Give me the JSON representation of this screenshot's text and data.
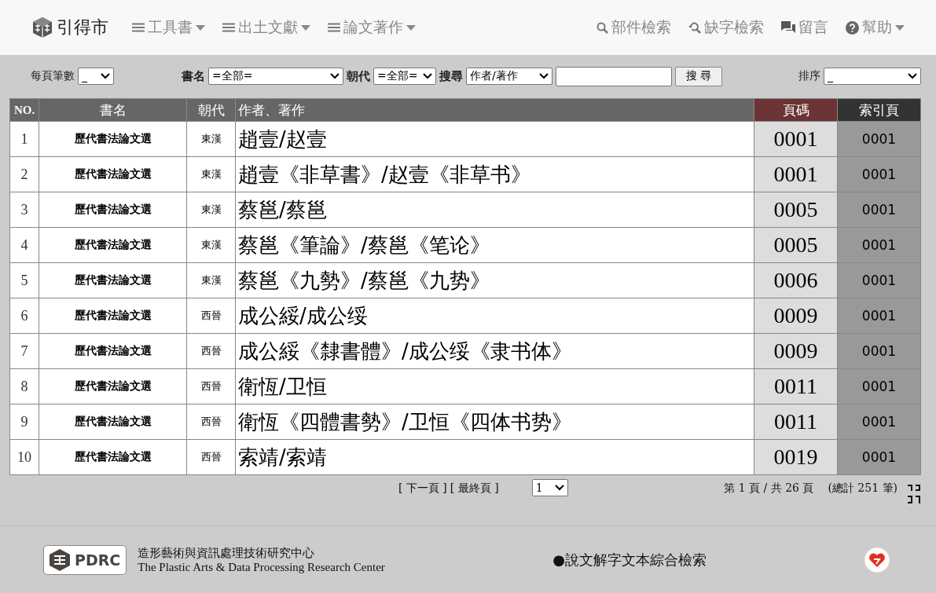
{
  "brand": {
    "title": "引得市"
  },
  "nav_left": [
    {
      "label": "工具書"
    },
    {
      "label": "出土文獻"
    },
    {
      "label": "論文著作"
    }
  ],
  "nav_right": [
    {
      "kind": "search",
      "label": "部件檢索"
    },
    {
      "kind": "search-back",
      "label": "缺字檢索"
    },
    {
      "kind": "comment",
      "label": "留言"
    },
    {
      "kind": "help",
      "label": "幫助",
      "dropdown": true
    }
  ],
  "filters": {
    "per_page": {
      "label": "每頁筆數",
      "value": "_"
    },
    "book": {
      "label": "書名",
      "value": "=全部="
    },
    "dynasty": {
      "label": "朝代",
      "value": "=全部="
    },
    "search": {
      "label": "搜尋",
      "field": "作者/著作",
      "button": "搜 尋"
    },
    "sort": {
      "label": "排序",
      "value": "_"
    }
  },
  "table": {
    "columns": [
      "NO.",
      "書名",
      "朝代",
      "作者、著作",
      "頁碼",
      "索引頁"
    ],
    "rows": [
      {
        "no": "1",
        "book": "歷代書法論文選",
        "dynasty": "東漢",
        "author": "趙壹/赵壹",
        "page": "0001",
        "index": "0001"
      },
      {
        "no": "2",
        "book": "歷代書法論文選",
        "dynasty": "東漢",
        "author": "趙壹《非草書》/赵壹《非草书》",
        "page": "0001",
        "index": "0001"
      },
      {
        "no": "3",
        "book": "歷代書法論文選",
        "dynasty": "東漢",
        "author": "蔡邕/蔡邕",
        "page": "0005",
        "index": "0001"
      },
      {
        "no": "4",
        "book": "歷代書法論文選",
        "dynasty": "東漢",
        "author": "蔡邕《筆論》/蔡邕《笔论》",
        "page": "0005",
        "index": "0001"
      },
      {
        "no": "5",
        "book": "歷代書法論文選",
        "dynasty": "東漢",
        "author": "蔡邕《九勢》/蔡邕《九势》",
        "page": "0006",
        "index": "0001"
      },
      {
        "no": "6",
        "book": "歷代書法論文選",
        "dynasty": "西晉",
        "author": "成公綏/成公绥",
        "page": "0009",
        "index": "0001"
      },
      {
        "no": "7",
        "book": "歷代書法論文選",
        "dynasty": "西晉",
        "author": "成公綏《隸書體》/成公绥《隶书体》",
        "page": "0009",
        "index": "0001"
      },
      {
        "no": "8",
        "book": "歷代書法論文選",
        "dynasty": "西晉",
        "author": "衛恆/卫恒",
        "page": "0011",
        "index": "0001"
      },
      {
        "no": "9",
        "book": "歷代書法論文選",
        "dynasty": "西晉",
        "author": "衛恆《四體書勢》/卫恒《四体书势》",
        "page": "0011",
        "index": "0001"
      },
      {
        "no": "10",
        "book": "歷代書法論文選",
        "dynasty": "西晉",
        "author": "索靖/索靖",
        "page": "0019",
        "index": "0001"
      }
    ]
  },
  "pagination": {
    "links": [
      "[ 下一頁 ]",
      "[ 最終頁 ]"
    ],
    "page_select": "1",
    "summary": "第 1 頁 / 共 26 頁",
    "total": "(總計 251 筆)"
  },
  "footer": {
    "logo": "PDRC",
    "org_zh": "造形藝術與資訊處理技術研究中心",
    "org_en": "The Plastic Arts & Data Processing Research Center",
    "link": "●說文解字文本綜合檢索"
  }
}
